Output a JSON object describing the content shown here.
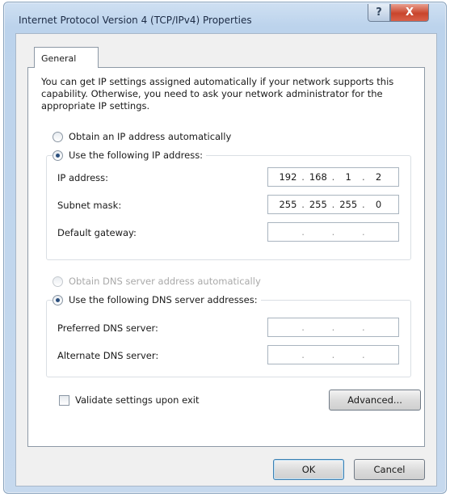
{
  "window": {
    "title": "Internet Protocol Version 4 (TCP/IPv4) Properties",
    "help_label": "?",
    "close_label": "X"
  },
  "tabs": [
    {
      "label": "General",
      "selected": true
    }
  ],
  "intro_text": "You can get IP settings assigned automatically if your network supports this capability. Otherwise, you need to ask your network administrator for the appropriate IP settings.",
  "ip_section": {
    "auto_label": "Obtain an IP address automatically",
    "manual_label": "Use the following IP address:",
    "selected": "manual",
    "fields": [
      {
        "label": "IP address:",
        "octets": [
          "192",
          "168",
          "1",
          "2"
        ]
      },
      {
        "label": "Subnet mask:",
        "octets": [
          "255",
          "255",
          "255",
          "0"
        ]
      },
      {
        "label": "Default gateway:",
        "octets": [
          "",
          "",
          "",
          ""
        ]
      }
    ]
  },
  "dns_section": {
    "auto_label": "Obtain DNS server address automatically",
    "manual_label": "Use the following DNS server addresses:",
    "selected": "manual",
    "fields": [
      {
        "label": "Preferred DNS server:",
        "octets": [
          "",
          "",
          "",
          ""
        ]
      },
      {
        "label": "Alternate DNS server:",
        "octets": [
          "",
          "",
          "",
          ""
        ]
      }
    ]
  },
  "validate_label": "Validate settings upon exit",
  "validate_checked": false,
  "buttons": {
    "advanced": "Advanced...",
    "ok": "OK",
    "cancel": "Cancel"
  },
  "colors": {
    "titlebar": "#c6d9ee",
    "close_button": "#c9452c",
    "radio_dot": "#2b4f7d"
  }
}
